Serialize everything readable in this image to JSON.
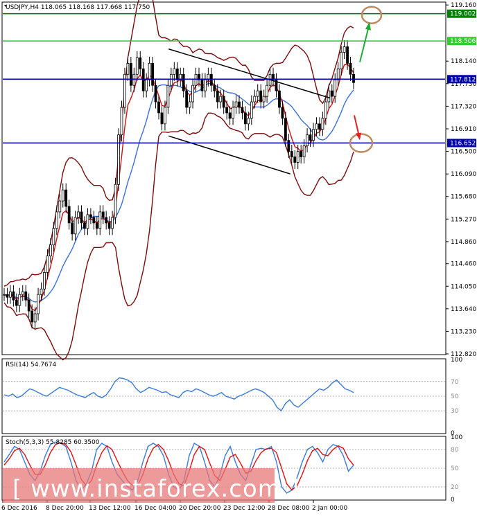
{
  "header": {
    "symbol_line": "USDJPY,H4  118.065 118.168 117.668 117.750"
  },
  "chart_data": {
    "type": "candlestick",
    "symbol": "USDJPY",
    "timeframe": "H4",
    "ohlc": {
      "open": 118.065,
      "high": 118.168,
      "low": 117.668,
      "close": 117.75
    },
    "x_ticks": [
      "6 Dec 2016",
      "8 Dec 20:00",
      "13 Dec 12:00",
      "16 Dec 04:00",
      "20 Dec 20:00",
      "23 Dec 12:00",
      "28 Dec 08:00",
      "2 Jan 00:00"
    ],
    "y_ticks": [
      "119.160",
      "118.140",
      "117.730",
      "117.320",
      "116.910",
      "116.500",
      "116.090",
      "115.680",
      "115.270",
      "114.860",
      "114.460",
      "114.050",
      "113.640",
      "113.230",
      "112.820"
    ],
    "ylim": [
      112.82,
      119.2
    ],
    "levels": [
      {
        "value": 119.002,
        "label": "119.002",
        "color": "#008000"
      },
      {
        "value": 118.506,
        "label": "118.506",
        "color": "#33cc33"
      },
      {
        "value": 117.812,
        "label": "117.812",
        "color": "#0000aa"
      },
      {
        "value": 116.652,
        "label": "116.652",
        "color": "#0000aa"
      }
    ],
    "channel": {
      "upper": [
        [
          0.375,
          118.36
        ],
        [
          0.74,
          117.47
        ]
      ],
      "lower": [
        [
          0.375,
          116.78
        ],
        [
          0.65,
          116.09
        ]
      ]
    },
    "annotations": [
      {
        "type": "arrow-up",
        "color": "#22aa33",
        "target": "119.002"
      },
      {
        "type": "arrow-down",
        "color": "#dd2222",
        "target": "116.652"
      }
    ],
    "price_series": [
      113.9,
      113.85,
      113.95,
      113.8,
      113.7,
      113.9,
      113.95,
      113.8,
      113.6,
      113.4,
      113.55,
      113.9,
      114.0,
      114.3,
      114.6,
      114.8,
      115.1,
      115.4,
      115.6,
      115.8,
      115.5,
      115.2,
      115.0,
      115.3,
      115.4,
      115.2,
      115.1,
      115.35,
      115.3,
      115.2,
      115.1,
      115.4,
      115.3,
      115.2,
      115.1,
      115.3,
      115.9,
      116.8,
      117.3,
      117.9,
      118.1,
      117.7,
      117.9,
      118.2,
      118.0,
      117.6,
      117.8,
      118.1,
      117.7,
      117.4,
      117.2,
      117.0,
      117.3,
      117.7,
      117.9,
      118.0,
      117.8,
      117.9,
      117.6,
      117.3,
      117.4,
      117.7,
      117.9,
      117.8,
      117.6,
      117.8,
      117.9,
      117.7,
      117.6,
      117.4,
      117.5,
      117.3,
      117.2,
      117.1,
      117.3,
      117.4,
      117.3,
      117.2,
      117.0,
      117.1,
      117.4,
      117.5,
      117.6,
      117.4,
      117.5,
      117.7,
      117.9,
      117.8,
      117.6,
      117.3,
      117.1,
      116.7,
      116.5,
      116.4,
      116.3,
      116.5,
      116.4,
      116.6,
      116.8,
      116.7,
      116.9,
      117.0,
      116.9,
      117.1,
      117.4,
      117.6,
      117.5,
      117.8,
      118.0,
      118.3,
      118.4,
      118.1,
      117.9,
      117.75
    ],
    "rsi": {
      "label": "RSI(14) 54.7674",
      "y_ticks": [
        "100",
        "70",
        "50",
        "30",
        "0"
      ],
      "values": [
        52,
        50,
        53,
        48,
        50,
        55,
        60,
        58,
        55,
        52,
        50,
        54,
        58,
        62,
        60,
        58,
        55,
        52,
        50,
        48,
        52,
        55,
        50,
        48,
        52,
        60,
        70,
        75,
        74,
        72,
        68,
        60,
        55,
        58,
        62,
        60,
        58,
        55,
        56,
        52,
        50,
        48,
        55,
        58,
        56,
        60,
        58,
        55,
        52,
        50,
        52,
        55,
        50,
        48,
        46,
        50,
        52,
        55,
        58,
        60,
        58,
        55,
        50,
        45,
        35,
        30,
        40,
        45,
        38,
        35,
        40,
        45,
        50,
        55,
        60,
        58,
        62,
        68,
        72,
        66,
        60,
        58,
        55
      ]
    },
    "stoch": {
      "label": "Stoch(5,3,3) 55.8285 60.3500",
      "y_ticks": [
        "100",
        "80",
        "50",
        "20",
        "0"
      ],
      "main": [
        60,
        72,
        85,
        80,
        60,
        40,
        30,
        45,
        70,
        88,
        92,
        90,
        85,
        60,
        30,
        15,
        25,
        45,
        80,
        90,
        85,
        60,
        40,
        30,
        20,
        15,
        30,
        60,
        85,
        90,
        85,
        70,
        40,
        20,
        15,
        30,
        70,
        90,
        85,
        60,
        30,
        20,
        40,
        70,
        85,
        60,
        40,
        30,
        55,
        80,
        82,
        80,
        85,
        60,
        20,
        10,
        15,
        35,
        60,
        80,
        85,
        75,
        60,
        80,
        88,
        85,
        70,
        45,
        55
      ],
      "signal": [
        55,
        65,
        78,
        82,
        72,
        55,
        40,
        40,
        55,
        75,
        88,
        91,
        88,
        76,
        55,
        32,
        22,
        30,
        55,
        75,
        86,
        80,
        62,
        45,
        30,
        22,
        22,
        40,
        65,
        82,
        88,
        80,
        62,
        40,
        25,
        22,
        45,
        72,
        85,
        80,
        58,
        38,
        30,
        48,
        68,
        72,
        58,
        42,
        45,
        62,
        75,
        81,
        82,
        75,
        50,
        25,
        15,
        22,
        40,
        62,
        78,
        82,
        72,
        70,
        80,
        86,
        82,
        65,
        55
      ]
    }
  },
  "watermark": {
    "text": "[  www.instaforex.com  ]"
  }
}
